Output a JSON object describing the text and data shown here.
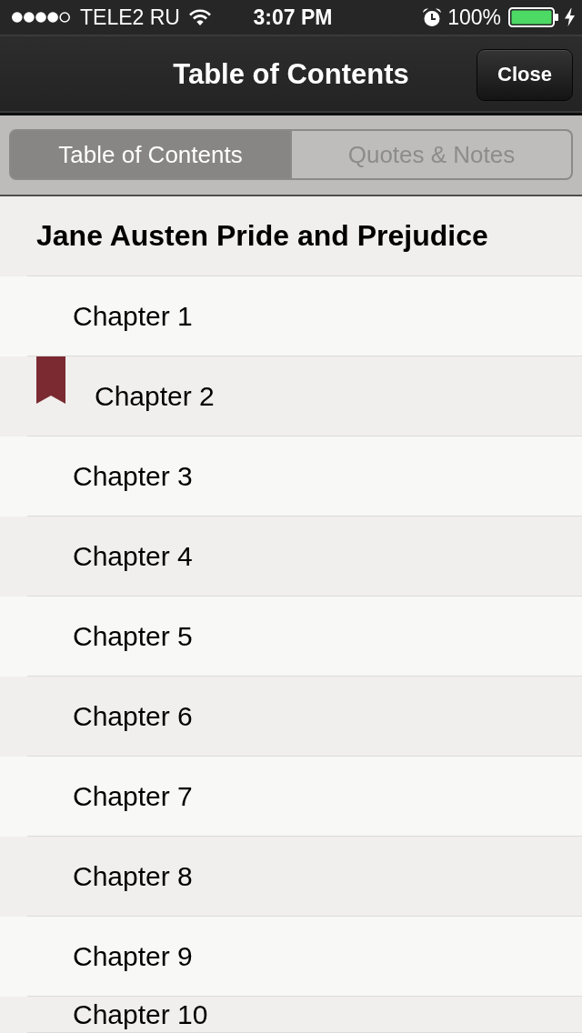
{
  "status_bar": {
    "carrier": "TELE2 RU",
    "time": "3:07 PM",
    "battery": "100%"
  },
  "nav_bar": {
    "title": "Table of Contents",
    "close_button": "Close"
  },
  "tabs": [
    {
      "label": "Table of Contents",
      "selected": true
    },
    {
      "label": "Quotes & Notes",
      "selected": false
    }
  ],
  "book": {
    "title": "Jane Austen Pride and Prejudice"
  },
  "chapters": [
    {
      "label": "Chapter 1",
      "bookmarked": false
    },
    {
      "label": "Chapter 2",
      "bookmarked": true
    },
    {
      "label": "Chapter 3",
      "bookmarked": false
    },
    {
      "label": "Chapter 4",
      "bookmarked": false
    },
    {
      "label": "Chapter 5",
      "bookmarked": false
    },
    {
      "label": "Chapter 6",
      "bookmarked": false
    },
    {
      "label": "Chapter 7",
      "bookmarked": false
    },
    {
      "label": "Chapter 8",
      "bookmarked": false
    },
    {
      "label": "Chapter 9",
      "bookmarked": false
    },
    {
      "label": "Chapter 10",
      "bookmarked": false
    }
  ]
}
